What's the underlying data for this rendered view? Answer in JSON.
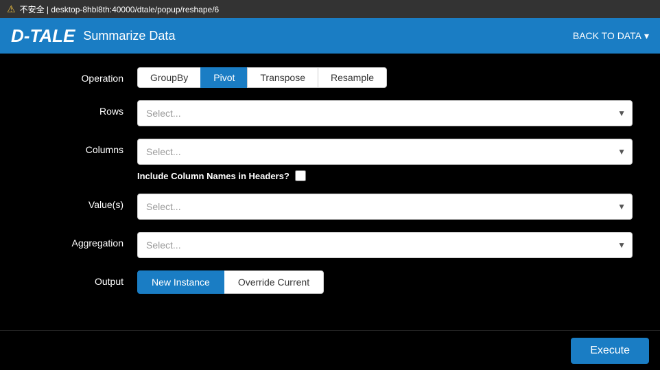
{
  "warning_bar": {
    "icon": "⚠",
    "text": "不安全 | desktop-8hbl8th:40000/dtale/popup/reshape/6"
  },
  "header": {
    "logo": "D-TALE",
    "title": "Summarize Data",
    "back_button": "BACK TO DATA",
    "back_chevron": "▾"
  },
  "form": {
    "operation_label": "Operation",
    "tabs": [
      {
        "id": "groupby",
        "label": "GroupBy",
        "active": false
      },
      {
        "id": "pivot",
        "label": "Pivot",
        "active": true
      },
      {
        "id": "transpose",
        "label": "Transpose",
        "active": false
      },
      {
        "id": "resample",
        "label": "Resample",
        "active": false
      }
    ],
    "rows_label": "Rows",
    "rows_placeholder": "Select...",
    "columns_label": "Columns",
    "columns_placeholder": "Select...",
    "include_col_names_label": "Include Column Names in Headers?",
    "values_label": "Value(s)",
    "values_placeholder": "Select...",
    "aggregation_label": "Aggregation",
    "aggregation_placeholder": "Select...",
    "output_label": "Output",
    "output_buttons": [
      {
        "id": "new-instance",
        "label": "New Instance",
        "active": true
      },
      {
        "id": "override-current",
        "label": "Override Current",
        "active": false
      }
    ]
  },
  "footer": {
    "execute_label": "Execute"
  }
}
